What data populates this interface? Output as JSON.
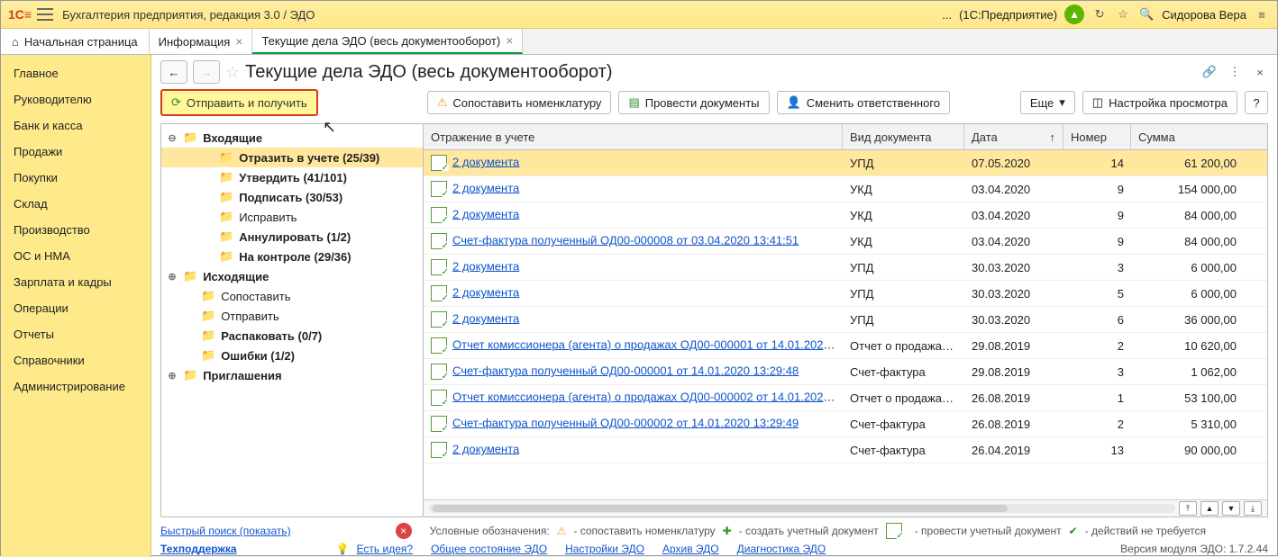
{
  "topbar": {
    "title": "Бухгалтерия предприятия, редакция 3.0 / ЭДО",
    "mode_dots": "...",
    "mode": "(1С:Предприятие)",
    "user": "Сидорова Вера"
  },
  "tabs": {
    "home": "Начальная страница",
    "items": [
      {
        "label": "Информация"
      },
      {
        "label": "Текущие дела ЭДО (весь документооборот)"
      }
    ]
  },
  "sidebar": {
    "items": [
      "Главное",
      "Руководителю",
      "Банк и касса",
      "Продажи",
      "Покупки",
      "Склад",
      "Производство",
      "ОС и НМА",
      "Зарплата и кадры",
      "Операции",
      "Отчеты",
      "Справочники",
      "Администрирование"
    ]
  },
  "page": {
    "title": "Текущие дела ЭДО (весь документооборот)",
    "send_recv": "Отправить и получить",
    "btn_compare": "Сопоставить номенклатуру",
    "btn_conduct": "Провести документы",
    "btn_change_owner": "Сменить ответственного",
    "btn_more": "Еще",
    "btn_view_settings": "Настройка просмотра",
    "help": "?"
  },
  "tree": [
    {
      "label": "Входящие",
      "depth": 0,
      "bold": true,
      "exp": "⊖"
    },
    {
      "label": "Отразить в учете (25/39)",
      "depth": 2,
      "bold": true,
      "sel": true
    },
    {
      "label": "Утвердить (41/101)",
      "depth": 2,
      "bold": true
    },
    {
      "label": "Подписать (30/53)",
      "depth": 2,
      "bold": true
    },
    {
      "label": "Исправить",
      "depth": 2
    },
    {
      "label": "Аннулировать (1/2)",
      "depth": 2,
      "bold": true
    },
    {
      "label": "На контроле (29/36)",
      "depth": 2,
      "bold": true
    },
    {
      "label": "Исходящие",
      "depth": 0,
      "bold": true,
      "exp": "⊕"
    },
    {
      "label": "Сопоставить",
      "depth": 1
    },
    {
      "label": "Отправить",
      "depth": 1
    },
    {
      "label": "Распаковать (0/7)",
      "depth": 1,
      "bold": true
    },
    {
      "label": "Ошибки (1/2)",
      "depth": 1,
      "bold": true
    },
    {
      "label": "Приглашения",
      "depth": 0,
      "bold": true,
      "exp": "⊕"
    }
  ],
  "grid": {
    "cols": {
      "c1": "Отражение в учете",
      "c2": "Вид документа",
      "c3": "Дата",
      "c3sort": "↑",
      "c4": "Номер",
      "c5": "Сумма"
    },
    "rows": [
      {
        "t": "2 документа",
        "kind": "УПД",
        "date": "07.05.2020",
        "num": "14",
        "sum": "61 200,00",
        "sel": true
      },
      {
        "t": "2 документа",
        "kind": "УКД",
        "date": "03.04.2020",
        "num": "9",
        "sum": "154 000,00"
      },
      {
        "t": "2 документа",
        "kind": "УКД",
        "date": "03.04.2020",
        "num": "9",
        "sum": "84 000,00"
      },
      {
        "t": "Счет-фактура полученный ОД00-000008 от 03.04.2020 13:41:51",
        "kind": "УКД",
        "date": "03.04.2020",
        "num": "9",
        "sum": "84 000,00"
      },
      {
        "t": "2 документа",
        "kind": "УПД",
        "date": "30.03.2020",
        "num": "3",
        "sum": "6 000,00"
      },
      {
        "t": "2 документа",
        "kind": "УПД",
        "date": "30.03.2020",
        "num": "5",
        "sum": "6 000,00"
      },
      {
        "t": "2 документа",
        "kind": "УПД",
        "date": "30.03.2020",
        "num": "6",
        "sum": "36 000,00"
      },
      {
        "t": "Отчет комиссионера (агента) о продажах ОД00-000001 от 14.01.2020...",
        "kind": "Отчет о продажах...",
        "date": "29.08.2019",
        "num": "2",
        "sum": "10 620,00"
      },
      {
        "t": "Счет-фактура полученный ОД00-000001 от 14.01.2020 13:29:48",
        "kind": "Счет-фактура",
        "date": "29.08.2019",
        "num": "3",
        "sum": "1 062,00"
      },
      {
        "t": "Отчет комиссионера (агента) о продажах ОД00-000002 от 14.01.2020...",
        "kind": "Отчет о продажах...",
        "date": "26.08.2019",
        "num": "1",
        "sum": "53 100,00"
      },
      {
        "t": "Счет-фактура полученный ОД00-000002 от 14.01.2020 13:29:49",
        "kind": "Счет-фактура",
        "date": "26.08.2019",
        "num": "2",
        "sum": "5 310,00"
      },
      {
        "t": "2 документа",
        "kind": "Счет-фактура",
        "date": "26.04.2019",
        "num": "13",
        "sum": "90 000,00"
      }
    ]
  },
  "footer": {
    "quicksearch": "Быстрый поиск (показать)",
    "legend_label": "Условные обозначения:",
    "l_warn": "- сопоставить номенклатуру",
    "l_plus": "- создать учетный документ",
    "l_doc": "- провести учетный документ",
    "l_ok": "- действий не требуется",
    "support": "Техподдержка",
    "idea": "Есть идея?",
    "links": [
      "Общее состояние ЭДО",
      "Настройки ЭДО",
      "Архив ЭДО",
      "Диагностика ЭДО"
    ],
    "version": "Версия модуля ЭДО: 1.7.2.44"
  }
}
